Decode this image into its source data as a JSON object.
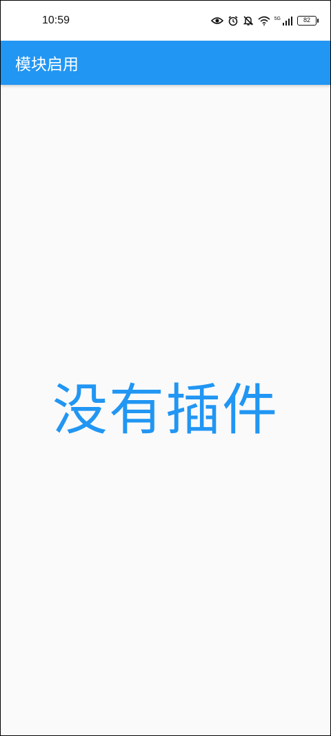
{
  "status_bar": {
    "time": "10:59",
    "network_label": "5G",
    "battery_level": "82",
    "icons": [
      "eye-icon",
      "alarm-icon",
      "bell-off-icon",
      "wifi-icon",
      "signal-icon",
      "battery-icon"
    ]
  },
  "app_bar": {
    "title": "模块启用",
    "background_color": "#2196f3"
  },
  "main": {
    "empty_message": "没有插件",
    "text_color": "#2196f3"
  }
}
